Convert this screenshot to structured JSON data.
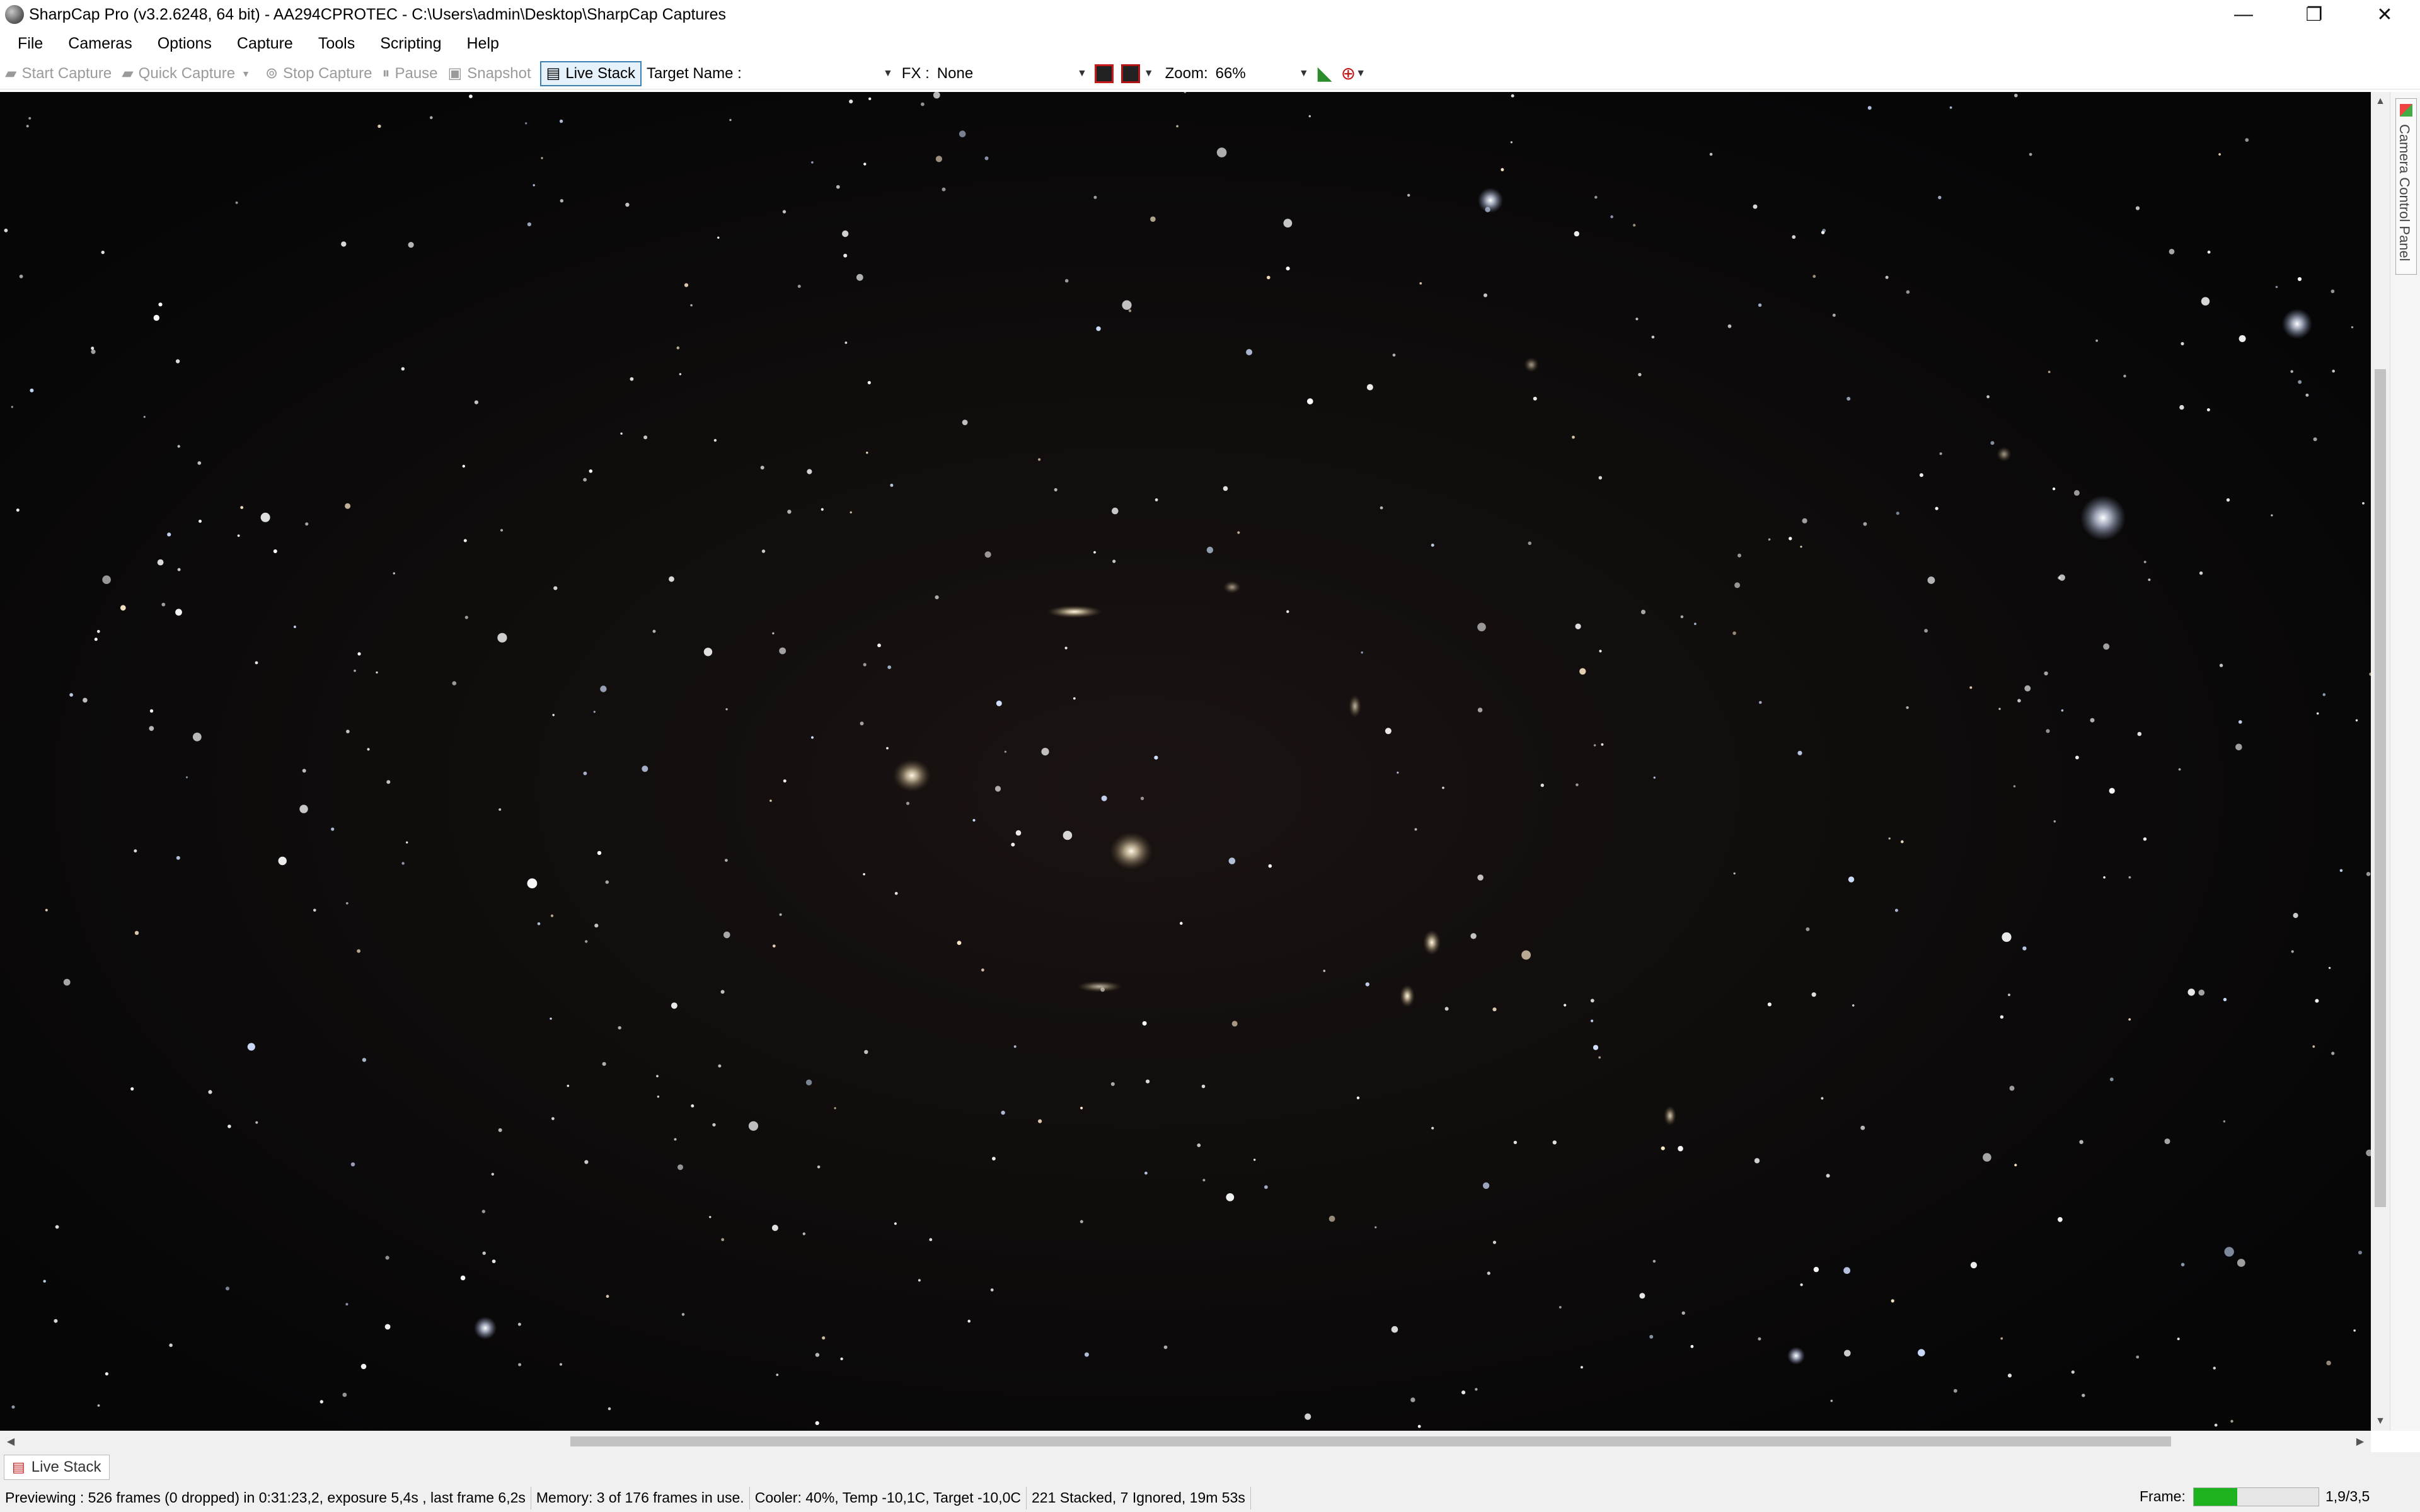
{
  "window": {
    "title": "SharpCap Pro (v3.2.6248, 64 bit) - AA294CPROTEC - C:\\Users\\admin\\Desktop\\SharpCap Captures",
    "controls": {
      "minimize": "—",
      "restore": "❐",
      "close": "✕"
    }
  },
  "menu": {
    "items": [
      "File",
      "Cameras",
      "Options",
      "Capture",
      "Tools",
      "Scripting",
      "Help"
    ]
  },
  "toolbar": {
    "start_capture": "Start Capture",
    "quick_capture": "Quick Capture",
    "stop_capture": "Stop Capture",
    "pause": "Pause",
    "snapshot": "Snapshot",
    "live_stack": "Live Stack",
    "target_name_label": "Target Name :",
    "target_name_value": "",
    "fx_label": "FX :",
    "fx_value": "None",
    "zoom_label": "Zoom:",
    "zoom_value": "66%"
  },
  "side_panel": {
    "tab_label": "Camera Control Panel"
  },
  "tabs": {
    "live_stack": "Live Stack"
  },
  "status": {
    "previewing": "Previewing : 526 frames (0 dropped) in 0:31:23,2, exposure 5,4s , last frame 6,2s",
    "memory": "Memory: 3 of 176 frames in use.",
    "cooler": "Cooler: 40%, Temp -10,1C, Target -10,0C",
    "stacked": "221 Stacked, 7 Ignored, 19m 53s",
    "frame_label": "Frame:",
    "frame_progress": 0.35,
    "frame_time": "1,9/3,5"
  },
  "colors": {
    "accent": "#3c7fb1",
    "sky_background": "#070708",
    "progress_fill": "#1fb31f"
  }
}
